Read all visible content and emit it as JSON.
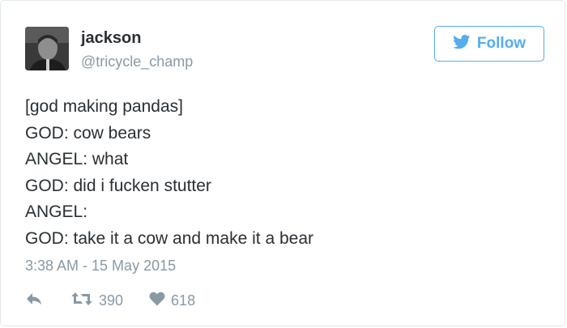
{
  "user": {
    "name": "jackson",
    "handle": "@tricycle_champ"
  },
  "follow": {
    "label": "Follow"
  },
  "tweet": {
    "lines": [
      "[god making pandas]",
      "GOD: cow bears",
      "ANGEL: what",
      "GOD: did i fucken stutter",
      "ANGEL:",
      "GOD: take it a cow and make it a bear"
    ],
    "timestamp": "3:38 AM - 15 May 2015"
  },
  "actions": {
    "retweets": "390",
    "likes": "618"
  },
  "colors": {
    "twitter_blue": "#55acee",
    "muted": "#8899a6",
    "text": "#292f33"
  },
  "icons": {
    "follow": "bird-icon",
    "reply": "reply-icon",
    "retweet": "retweet-icon",
    "like": "heart-icon"
  }
}
